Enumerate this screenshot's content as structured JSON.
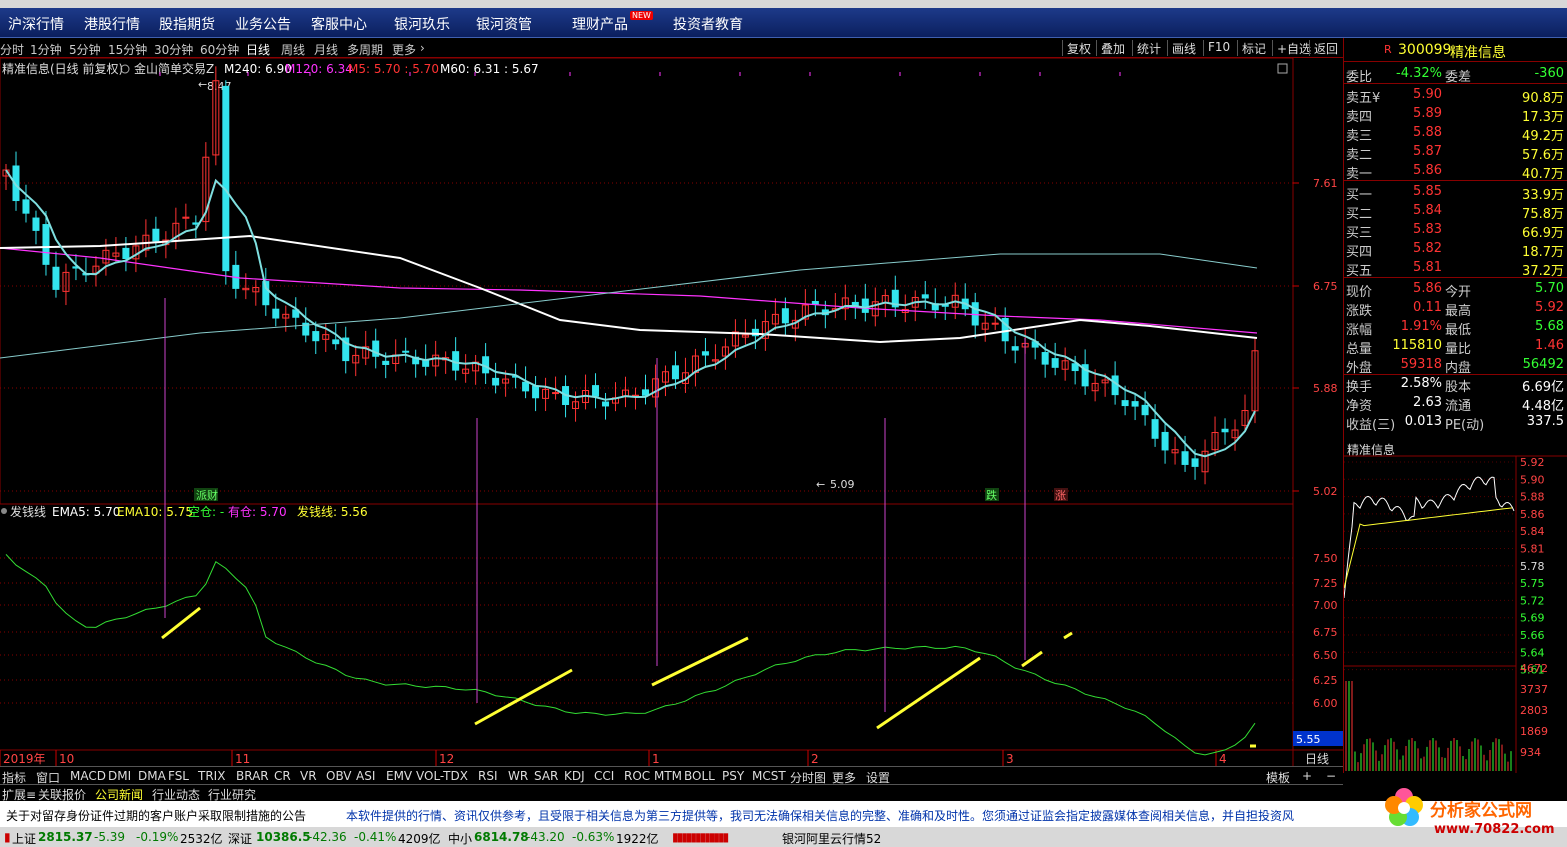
{
  "nav": {
    "items": [
      "沪深行情",
      "港股行情",
      "股指期货",
      "业务公告",
      "客服中心",
      "银河玖乐",
      "银河资管",
      "理财产品",
      "投资者教育"
    ],
    "new_badge": "NEW"
  },
  "periods": [
    "分时",
    "1分钟",
    "5分钟",
    "15分钟",
    "30分钟",
    "60分钟",
    "日线",
    "周线",
    "月线",
    "多周期",
    "更多"
  ],
  "active_period": "日线",
  "tools": [
    "复权",
    "叠加",
    "统计",
    "画线",
    "F10",
    "标记",
    "+自选",
    "返回"
  ],
  "legend_main": {
    "name": "精准信息(日线 前复权)",
    "formula": "金山简单交易Z",
    "m240": "M240: 6.90",
    "m120": "M120: 6.34",
    "m5": "M5: 5.70 : 5.70",
    "m60": "M60: 6.31 : 5.67"
  },
  "legend_sub": {
    "name": "发钱线",
    "ema5": "EMA5: 5.70",
    "ema10": "EMA10: 5.75",
    "empty": "空仓: -",
    "hold": "有仓: 5.70",
    "fq": "发钱线: 5.56"
  },
  "annot": {
    "high": "8.47",
    "low": "5.09",
    "tag1": "派财",
    "tag2": "跌",
    "tag3": "涨"
  },
  "price_axis": [
    "7.61",
    "6.75",
    "5.88",
    "5.02"
  ],
  "sub_axis": [
    "7.50",
    "7.25",
    "7.00",
    "6.75",
    "6.50",
    "6.25",
    "6.00"
  ],
  "sub_last": "5.55",
  "date_axis": [
    "2019年",
    "10",
    "11",
    "12",
    "1",
    "2",
    "3",
    "4"
  ],
  "date_label_right": "日线",
  "quote": {
    "code": "300099",
    "name": "精准信息",
    "weibi_label": "委比",
    "weibi": "-4.32%",
    "weicha_label": "委差",
    "weicha": "-360",
    "asks": [
      {
        "l": "卖五¥",
        "p": "5.90",
        "v": "90.8万"
      },
      {
        "l": "卖四",
        "p": "5.89",
        "v": "17.3万"
      },
      {
        "l": "卖三",
        "p": "5.88",
        "v": "49.2万"
      },
      {
        "l": "卖二",
        "p": "5.87",
        "v": "57.6万"
      },
      {
        "l": "卖一",
        "p": "5.86",
        "v": "40.7万"
      }
    ],
    "bids": [
      {
        "l": "买一",
        "p": "5.85",
        "v": "33.9万"
      },
      {
        "l": "买二",
        "p": "5.84",
        "v": "75.8万"
      },
      {
        "l": "买三",
        "p": "5.83",
        "v": "66.9万"
      },
      {
        "l": "买四",
        "p": "5.82",
        "v": "18.7万"
      },
      {
        "l": "买五",
        "p": "5.81",
        "v": "37.2万"
      }
    ],
    "stats": [
      {
        "l1": "现价",
        "v1": "5.86",
        "c1": "red",
        "l2": "今开",
        "v2": "5.70",
        "c2": "green"
      },
      {
        "l1": "涨跌",
        "v1": "0.11",
        "c1": "red",
        "l2": "最高",
        "v2": "5.92",
        "c2": "red"
      },
      {
        "l1": "涨幅",
        "v1": "1.91%",
        "c1": "red",
        "l2": "最低",
        "v2": "5.68",
        "c2": "green"
      },
      {
        "l1": "总量",
        "v1": "115810",
        "c1": "yellow",
        "l2": "量比",
        "v2": "1.46",
        "c2": "red"
      },
      {
        "l1": "外盘",
        "v1": "59318",
        "c1": "red",
        "l2": "内盘",
        "v2": "56492",
        "c2": "green"
      },
      {
        "l1": "换手",
        "v1": "2.58%",
        "c1": "white",
        "l2": "股本",
        "v2": "6.69亿",
        "c2": "white"
      },
      {
        "l1": "净资",
        "v1": "2.63",
        "c1": "white",
        "l2": "流通",
        "v2": "4.48亿",
        "c2": "white"
      },
      {
        "l1": "收益(三)",
        "v1": "0.013",
        "c1": "white",
        "l2": "PE(动)",
        "v2": "337.5",
        "c2": "white"
      }
    ]
  },
  "mini": {
    "title": "精准信息",
    "axis": [
      "5.92",
      "5.90",
      "5.88",
      "5.86",
      "5.84",
      "5.81",
      "5.78",
      "5.75",
      "5.72",
      "5.69",
      "5.66",
      "5.64",
      "5.61"
    ],
    "vol_axis": [
      "4672",
      "3737",
      "2803",
      "1869",
      "934"
    ]
  },
  "indicators": [
    "指标",
    "窗口",
    "MACD",
    "DMI",
    "DMA",
    "FSL",
    "TRIX",
    "BRAR",
    "CR",
    "VR",
    "OBV",
    "ASI",
    "EMV",
    "VOL-TDX",
    "RSI",
    "WR",
    "SAR",
    "KDJ",
    "CCI",
    "ROC",
    "MTM",
    "BOLL",
    "PSY",
    "MCST",
    "分时图",
    "更多",
    "设置"
  ],
  "template_label": "模板",
  "info_tabs": [
    "扩展≡",
    "关联报价",
    "公司新闻",
    "行业动态",
    "行业研究"
  ],
  "notice": {
    "left": "关于对留存身份证件过期的客户账户采取限制措施的公告",
    "right": "本软件提供的行情、资讯仅供参考，且受限于相关信息为第三方提供等，我司无法确保相关信息的完整、准确和及时性。您须通过证监会指定披露媒体查阅相关信息，并自担投资风"
  },
  "status": {
    "sh_name": "上证",
    "sh": "2815.37",
    "sh_ch": "-5.39",
    "sh_pct": "-0.19%",
    "sh_amt": "2532亿",
    "sz_name": "深证",
    "sz": "10386.5",
    "sz_ch": "-42.36",
    "sz_pct": "-0.41%",
    "sz_amt": "4209亿",
    "zx_name": "中小",
    "zx": "6814.78",
    "zx_ch": "-43.20",
    "zx_pct": "-0.63%",
    "zx_amt": "1922亿",
    "server": "银河阿里云行情52"
  },
  "logo": {
    "text": "分析家公式网",
    "url": "www.70822.com"
  }
}
